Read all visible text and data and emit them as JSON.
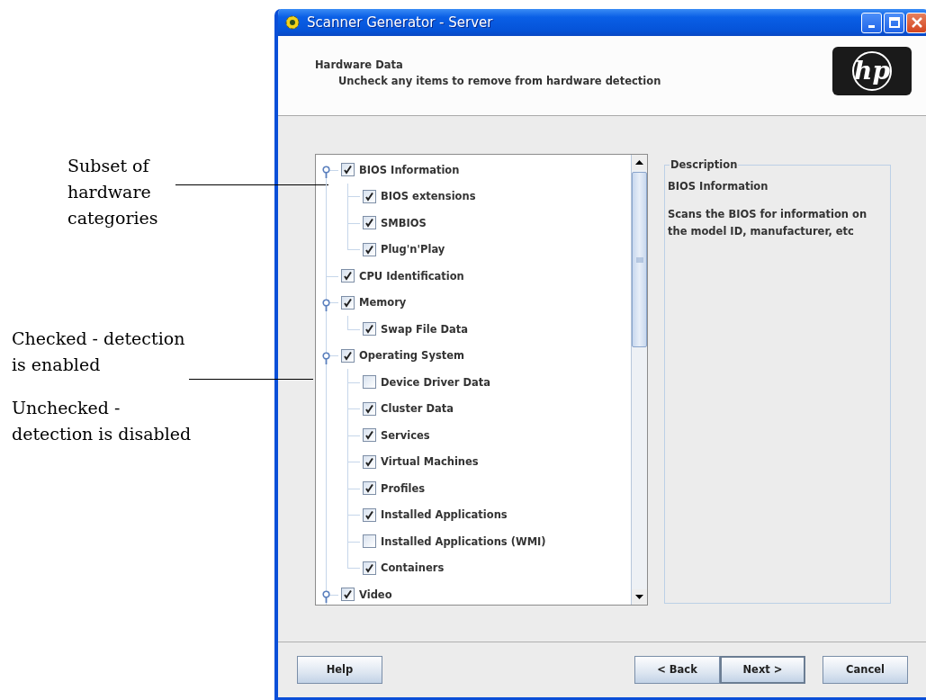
{
  "annotations": [
    {
      "lines": [
        "Subset of",
        "hardware",
        "categories"
      ]
    },
    {
      "lines": [
        "Checked - detection",
        "is enabled"
      ]
    },
    {
      "lines": [
        "Unchecked -",
        "detection is disabled"
      ]
    }
  ],
  "window": {
    "title": "Scanner Generator - Server"
  },
  "header": {
    "title": "Hardware Data",
    "subtitle": "Uncheck any items to remove from hardware detection",
    "logo": "hp"
  },
  "tree": [
    {
      "label": "BIOS Information",
      "checked": true,
      "expanded": true,
      "children": [
        {
          "label": "BIOS extensions",
          "checked": true
        },
        {
          "label": "SMBIOS",
          "checked": true
        },
        {
          "label": "Plug'n'Play",
          "checked": true
        }
      ]
    },
    {
      "label": "CPU Identification",
      "checked": true
    },
    {
      "label": "Memory",
      "checked": true,
      "expanded": true,
      "children": [
        {
          "label": "Swap File Data",
          "checked": true
        }
      ]
    },
    {
      "label": "Operating System",
      "checked": true,
      "expanded": true,
      "children": [
        {
          "label": "Device Driver Data",
          "checked": false
        },
        {
          "label": "Cluster Data",
          "checked": true
        },
        {
          "label": "Services",
          "checked": true
        },
        {
          "label": "Virtual Machines",
          "checked": true
        },
        {
          "label": "Profiles",
          "checked": true
        },
        {
          "label": "Installed Applications",
          "checked": true
        },
        {
          "label": "Installed Applications (WMI)",
          "checked": false
        },
        {
          "label": "Containers",
          "checked": true
        }
      ]
    },
    {
      "label": "Video",
      "checked": true,
      "expanded": true
    }
  ],
  "description": {
    "legend": "Description",
    "title": "BIOS Information",
    "text": "Scans the BIOS for information on the model ID, manufacturer, etc"
  },
  "buttons": [
    {
      "label": "Help",
      "kind": "help",
      "default": false
    },
    {
      "label": "< Back",
      "kind": "nav",
      "default": false
    },
    {
      "label": "Next >",
      "kind": "nav",
      "default": true
    },
    {
      "label": "Cancel",
      "kind": "cancel",
      "default": false
    }
  ]
}
